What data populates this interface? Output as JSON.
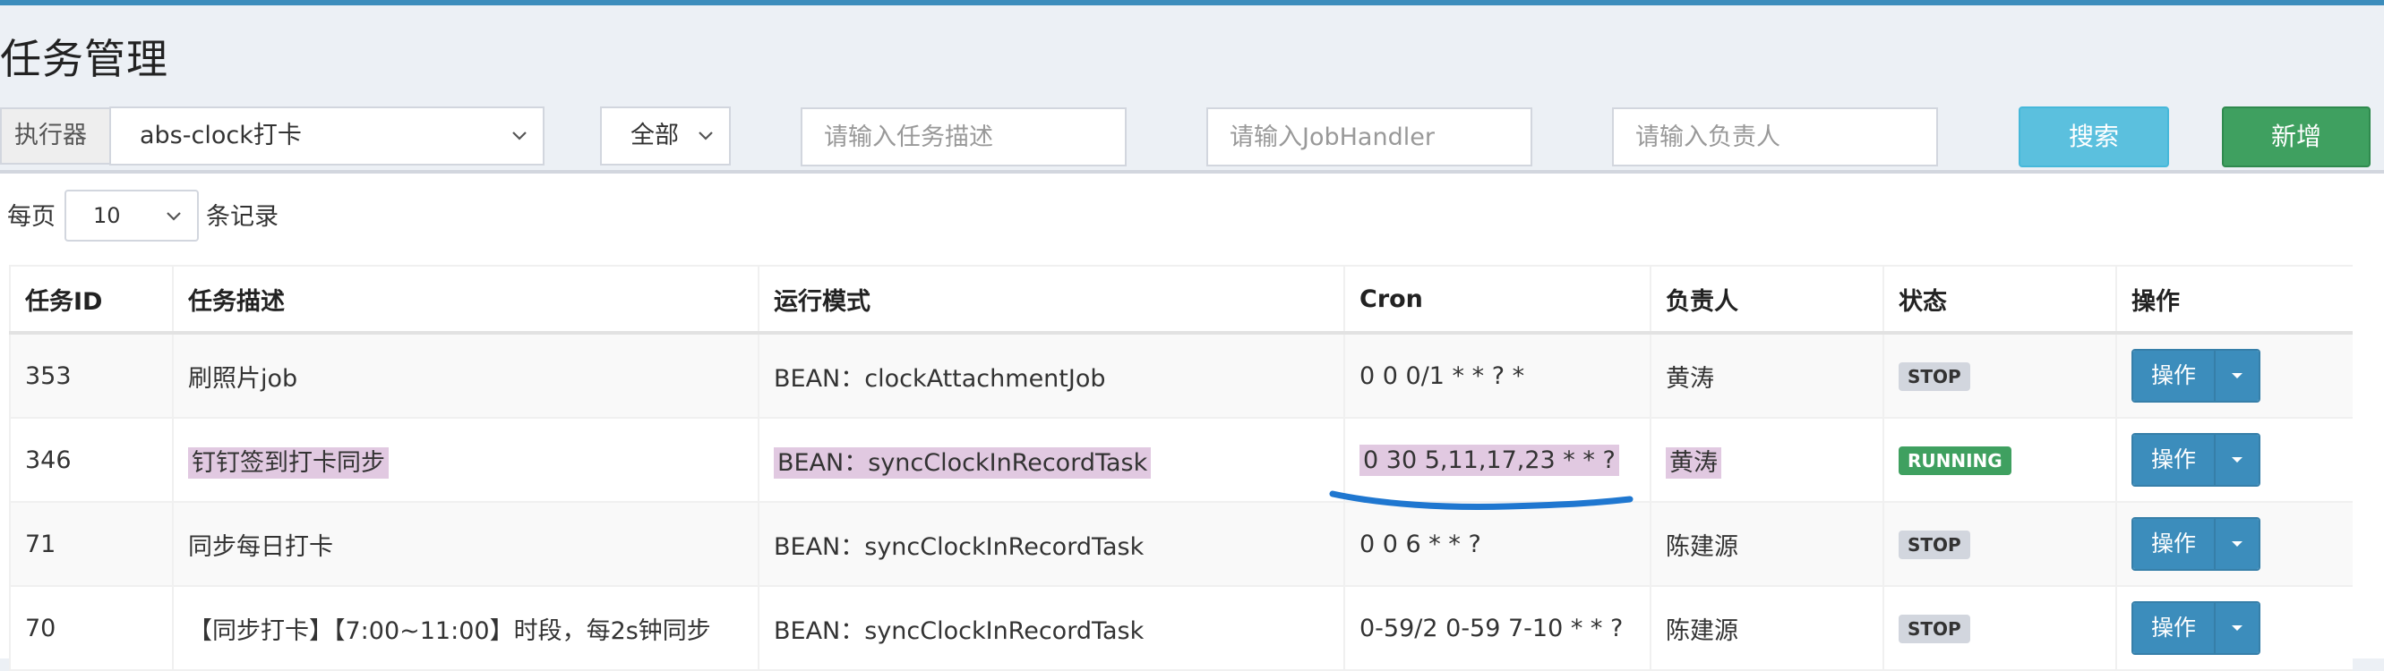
{
  "page": {
    "title": "任务管理"
  },
  "filters": {
    "executor_label": "执行器",
    "executor_value": "abs-clock打卡",
    "status_value": "全部",
    "desc_placeholder": "请输入任务描述",
    "handler_placeholder": "请输入JobHandler",
    "owner_placeholder": "请输入负责人",
    "search_label": "搜索",
    "add_label": "新增"
  },
  "length": {
    "prefix": "每页",
    "value": "10",
    "suffix": "条记录"
  },
  "table": {
    "headers": [
      "任务ID",
      "任务描述",
      "运行模式",
      "Cron",
      "负责人",
      "状态",
      "操作"
    ],
    "rows": [
      {
        "id": "353",
        "desc": "刷照片job",
        "mode": "BEAN：clockAttachmentJob",
        "cron": "0 0 0/1 * * ? *",
        "owner": "黄涛",
        "status": "STOP",
        "action": "操作"
      },
      {
        "id": "346",
        "desc": "钉钉签到打卡同步",
        "mode": "BEAN：syncClockInRecordTask",
        "cron": "0 30 5,11,17,23 * * ?",
        "owner": "黄涛",
        "status": "RUNNING",
        "action": "操作"
      },
      {
        "id": "71",
        "desc": "同步每日打卡",
        "mode": "BEAN：syncClockInRecordTask",
        "cron": "0 0 6 * * ?",
        "owner": "陈建源",
        "status": "STOP",
        "action": "操作"
      },
      {
        "id": "70",
        "desc": "【同步打卡】【7:00~11:00】时段，每2s钟同步",
        "mode": "BEAN：syncClockInRecordTask",
        "cron": "0-59/2 0-59 7-10 * * ?",
        "owner": "陈建源",
        "status": "STOP",
        "action": "操作"
      }
    ]
  },
  "colors": {
    "accent": "#3c8dbc",
    "search": "#5bc0de",
    "add": "#3fa060",
    "highlight": "#e1c9e1",
    "annotation": "#1f77d0"
  },
  "icons": {
    "select_caret": "chevron-down-icon",
    "split_caret": "caret-down-icon"
  }
}
